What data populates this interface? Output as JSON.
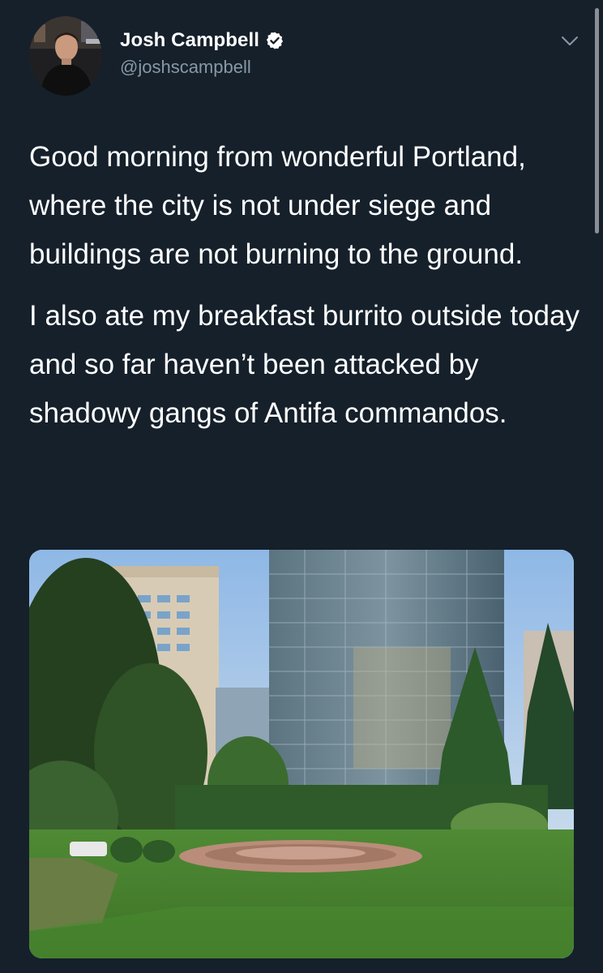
{
  "tweet": {
    "author": {
      "display_name": "Josh Campbell",
      "handle": "@joshscampbell",
      "verified": true
    },
    "paragraphs": [
      "Good morning from wonderful Portland, where the city is not under siege and buildings are not burning to the ground.",
      "I also ate my breakfast burrito outside today and so far haven’t been attacked by shadowy gangs of Antifa commandos."
    ],
    "media": {
      "type": "photo"
    }
  },
  "theme": {
    "background": "#15202b",
    "text": "#ffffff",
    "secondary_text": "#8899a6",
    "verified_badge": "#ffffff"
  },
  "icons": {
    "verified": "verified-badge-icon",
    "more": "chevron-down-icon"
  }
}
